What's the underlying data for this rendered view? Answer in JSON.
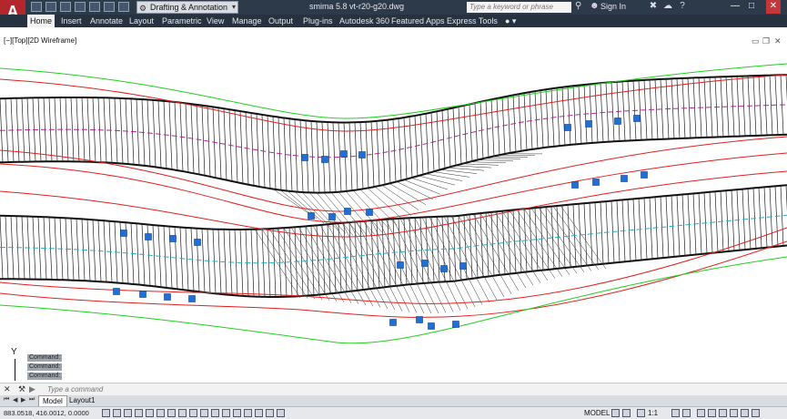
{
  "titlebar": {
    "logo": "A",
    "workspace": "Drafting & Annotation",
    "document_title": "smima 5.8 vt-r20-g20.dwg",
    "search_placeholder": "Type a keyword or phrase",
    "sign_in": "Sign In"
  },
  "ribbon": {
    "tabs": [
      "Home",
      "Insert",
      "Annotate",
      "Layout",
      "Parametric",
      "View",
      "Manage",
      "Output",
      "Plug-ins",
      "Autodesk 360",
      "Featured Apps",
      "Express Tools"
    ]
  },
  "viewport": {
    "label": "[−][Top][2D Wireframe]"
  },
  "command": {
    "history": [
      "Command:",
      "Command:",
      "Command:"
    ],
    "placeholder": "Type a command"
  },
  "layout_tabs": [
    "Model",
    "Layout1"
  ],
  "status": {
    "coordinates": "883.0518, 416.0012, 0.0000",
    "model_label": "MODEL",
    "scale": "1:1"
  },
  "colors": {
    "titlebar": "#2c3a4a",
    "ribbon": "#273241",
    "logo_red": "#b3262b",
    "grip_blue": "#1f6fd6",
    "offset_red": "#e02020",
    "offset_green": "#20d020",
    "centerline_magenta": "#c02090",
    "centerline_cyan": "#20b0c8"
  },
  "icons": {
    "app": "autocad-logo-icon",
    "search": "binoculars-icon",
    "user": "user-icon",
    "close": "close-icon"
  }
}
